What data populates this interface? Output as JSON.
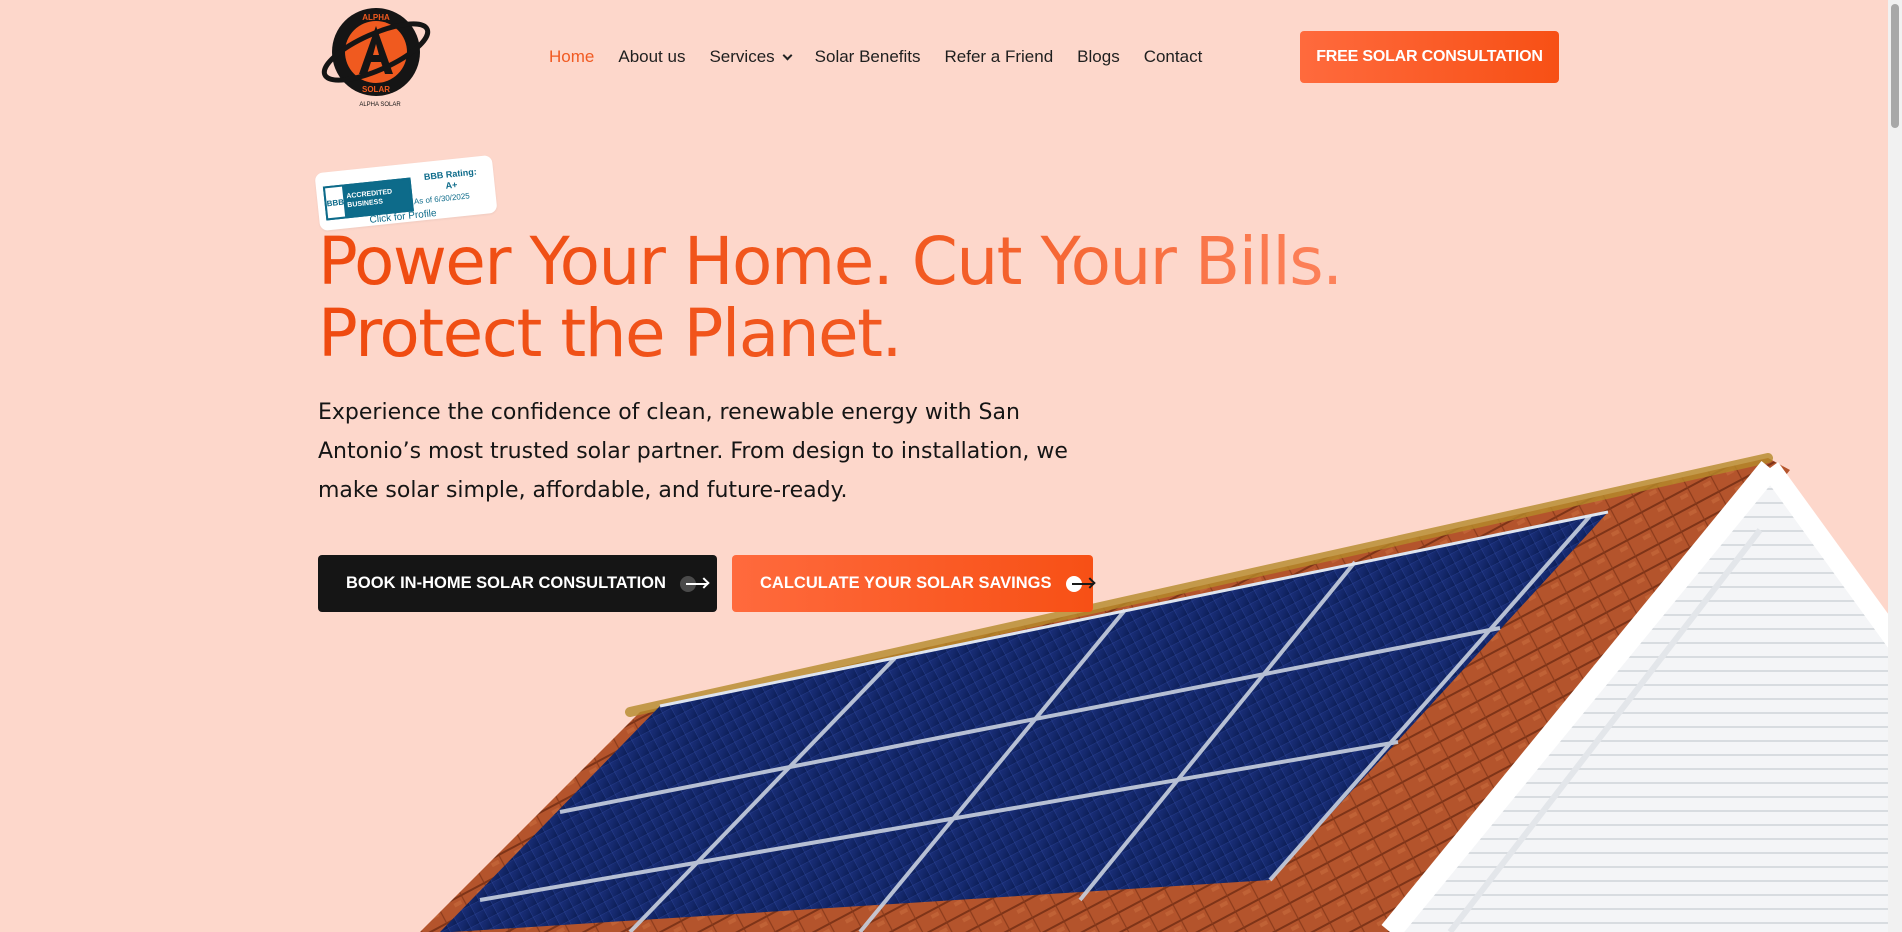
{
  "brand": {
    "logo_text_top": "ALPHA",
    "logo_text_bottom": "SOLAR",
    "logo_caption": "ALPHA SOLAR"
  },
  "nav": {
    "items": [
      {
        "label": "Home",
        "active": true
      },
      {
        "label": "About us"
      },
      {
        "label": "Services",
        "dropdown": true
      },
      {
        "label": "Solar Benefits"
      },
      {
        "label": "Refer a Friend"
      },
      {
        "label": "Blogs"
      },
      {
        "label": "Contact"
      }
    ],
    "cta_label": "FREE SOLAR CONSULTATION"
  },
  "bbb": {
    "seal_logo": "BBB",
    "seal_text": "ACCREDITED BUSINESS",
    "rating_label": "BBB Rating:",
    "rating_value": "A+",
    "date": "As of 6/30/2025",
    "link": "Click for Profile"
  },
  "hero": {
    "title_line1": "Power Your Home. Cut Your Bills.",
    "title_line2": "Protect the Planet.",
    "subtitle": "Experience the confidence of clean, renewable energy with San Antonio’s most trusted solar partner. From design to installation, we make solar simple, affordable, and future-ready.",
    "primary_button": "BOOK IN-HOME SOLAR CONSULTATION",
    "secondary_button": "CALCULATE YOUR SOLAR SAVINGS"
  },
  "colors": {
    "background": "#fdd7cb",
    "accent": "#f75015",
    "dark": "#151515"
  },
  "icons": {
    "nav_dropdown": "chevron-down-icon",
    "button_arrow": "arrow-right-icon"
  }
}
